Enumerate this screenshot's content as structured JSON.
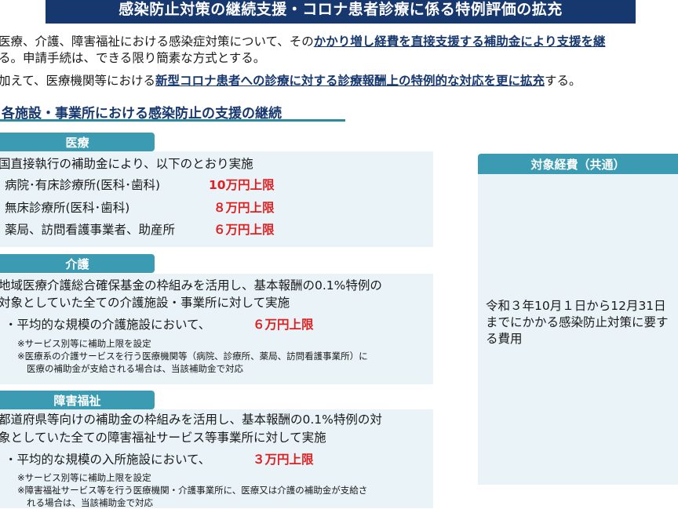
{
  "title": "感染防止対策の継続支援・コロナ患者診療に係る特例評価の拡充",
  "intro": {
    "line1_pre": "医療、介護、障害福祉における感染症対策について、その",
    "line1_hl": "かかり増し経費を直接支援する補助金により支援を継",
    "line2": "る。申請手続は、できる限り簡素な方式とする。",
    "line3_pre": "加えて、医療機関等における",
    "line3_hl": "新型コロナ患者への診療に対する診療報酬上の特例的な対応を更に拡充",
    "line3_post": "する。"
  },
  "section_heading": "各施設・事業所における感染防止の支援の継続",
  "medical": {
    "tab": "医療",
    "lead": "国直接執行の補助金により、以下のとおり実施",
    "items": [
      {
        "label": "病院･有床診療所(医科･歯科)",
        "amount": "10万円上限"
      },
      {
        "label": "無床診療所(医科･歯科)",
        "amount": "８万円上限"
      },
      {
        "label": "薬局、訪問看護事業者、助産所",
        "amount": "６万円上限"
      }
    ]
  },
  "care": {
    "tab": "介護",
    "lead1": "地域医療介護総合確保基金の枠組みを活用し、基本報酬の0.1%特例の",
    "lead2": "対象としていた全ての介護施設・事業所に対して実施",
    "bullet": "・平均的な規模の介護施設において、",
    "amount": "６万円上限",
    "note1": "※サービス別等に補助上限を設定",
    "note2": "※医療系の介護サービスを行う医療機関等（病院、診療所、薬局、訪問看護事業所）に",
    "note3": "医療の補助金が支給される場合は、当該補助金で対応"
  },
  "disability": {
    "tab": "障害福祉",
    "lead1": "都道府県等向けの補助金の枠組みを活用し、基本報酬の0.1%特例の対",
    "lead2": "象としていた全ての障害福祉サービス等事業所に対して実施",
    "bullet": "・平均的な規模の入所施設において、",
    "amount": "３万円上限",
    "note1": "※サービス別等に補助上限を設定",
    "note2": "※障害福祉サービス等を行う医療機関・介護事業所に、医療又は介護の補助金が支給さ",
    "note3": "れる場合は、当該補助金で対応"
  },
  "side": {
    "tab": "対象経費（共通）",
    "line1": "令和３年10月１日から12月31日",
    "line2": "までにかかる感染防止対策に要す",
    "line3": "る費用"
  }
}
